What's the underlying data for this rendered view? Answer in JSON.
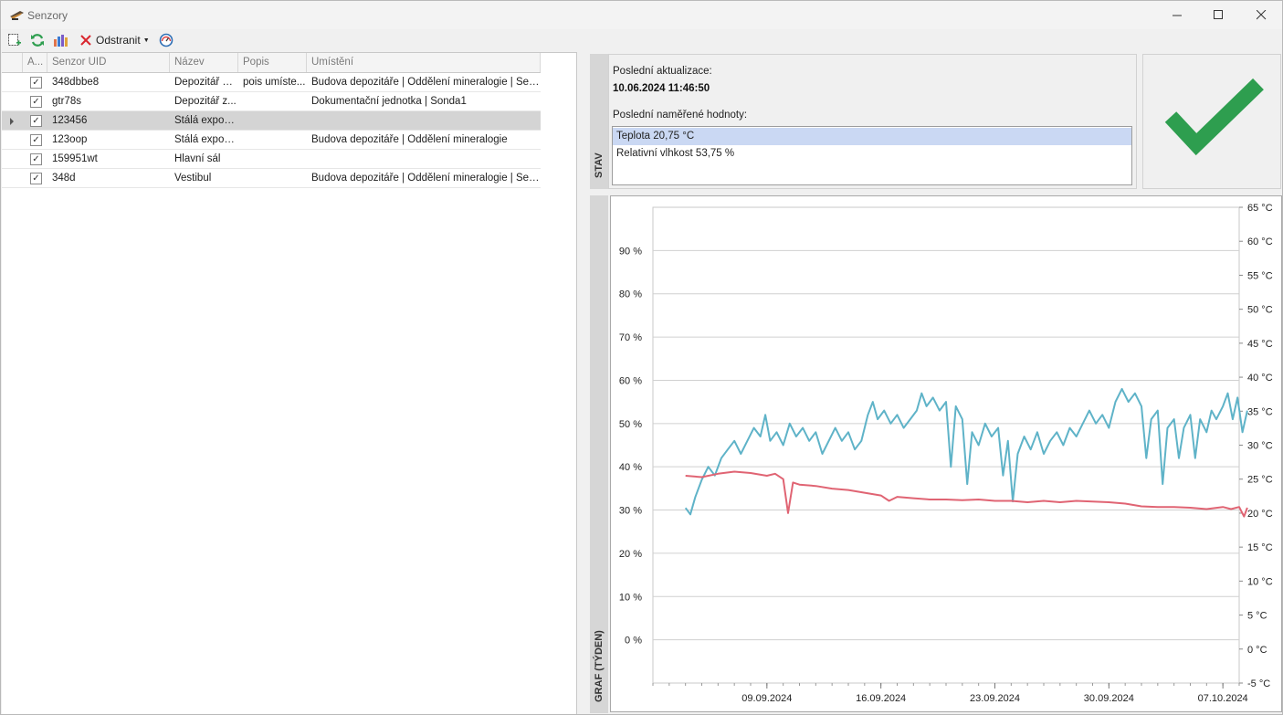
{
  "window": {
    "title": "Senzory"
  },
  "toolbar": {
    "delete_label": "Odstranit"
  },
  "grid": {
    "columns": [
      "A...",
      "Senzor UID",
      "Název",
      "Popis",
      "Umístění"
    ],
    "rows": [
      {
        "active": true,
        "uid": "348dbbe8",
        "name": "Depozitář 2 ...",
        "desc": "pois umíste...",
        "location": "Budova depozitáře | Oddělení mineralogie | Sekce 1"
      },
      {
        "active": true,
        "uid": "gtr78s",
        "name": "Depozitář z...",
        "desc": "",
        "location": "Dokumentační jednotka | Sonda1"
      },
      {
        "active": true,
        "uid": "123456",
        "name": "Stálá expozi...",
        "desc": "",
        "location": ""
      },
      {
        "active": true,
        "uid": "123oop",
        "name": "Stálá expozi...",
        "desc": "",
        "location": "Budova depozitáře | Oddělení mineralogie"
      },
      {
        "active": true,
        "uid": "159951wt",
        "name": "Hlavní sál",
        "desc": "",
        "location": ""
      },
      {
        "active": true,
        "uid": "348d",
        "name": "Vestibul",
        "desc": "",
        "location": "Budova depozitáře | Oddělení mineralogie | Sekce 1"
      }
    ],
    "selected_row": 2
  },
  "status": {
    "panel_label": "STAV",
    "last_update_label": "Poslední aktualizace:",
    "last_update_value": "10.06.2024 11:46:50",
    "last_values_label": "Poslední naměřené hodnoty:",
    "values": [
      "Teplota 20,75 °C",
      "Relativní vlhkost 53,75 %"
    ],
    "state": "ok",
    "state_color": "#2e9e4f"
  },
  "chart_panel_label": "GRAF (TÝDEN)",
  "chart_data": {
    "type": "line",
    "x_ticks": [
      "09.09.2024",
      "16.09.2024",
      "23.09.2024",
      "30.09.2024",
      "07.10.2024"
    ],
    "x_range": [
      "2024-09-02",
      "2024-10-08"
    ],
    "y_left": {
      "ticks": [
        "0 %",
        "10 %",
        "20 %",
        "30 %",
        "40 %",
        "50 %",
        "60 %",
        "70 %",
        "80 %",
        "90 %"
      ],
      "range": [
        -10,
        100
      ]
    },
    "y_right": {
      "ticks": [
        "-5 °C",
        "0 °C",
        "5 °C",
        "10 °C",
        "15 °C",
        "20 °C",
        "25 °C",
        "30 °C",
        "35 °C",
        "40 °C",
        "45 °C",
        "50 °C",
        "55 °C",
        "60 °C",
        "65 °C"
      ],
      "range": [
        -5,
        65
      ]
    },
    "grid": true,
    "series": [
      {
        "axis": "left",
        "color": "#5fb3c8",
        "points": [
          [
            "2024-09-04",
            30.5
          ],
          [
            "2024-09-04.3",
            29
          ],
          [
            "2024-09-04.6",
            33
          ],
          [
            "2024-09-05",
            37
          ],
          [
            "2024-09-05.4",
            40
          ],
          [
            "2024-09-05.8",
            38
          ],
          [
            "2024-09-06.2",
            42
          ],
          [
            "2024-09-06.6",
            44
          ],
          [
            "2024-09-07",
            46
          ],
          [
            "2024-09-07.4",
            43
          ],
          [
            "2024-09-07.8",
            46
          ],
          [
            "2024-09-08.2",
            49
          ],
          [
            "2024-09-08.6",
            47
          ],
          [
            "2024-09-08.9",
            52
          ],
          [
            "2024-09-09.2",
            46
          ],
          [
            "2024-09-09.6",
            48
          ],
          [
            "2024-09-10",
            45
          ],
          [
            "2024-09-10.4",
            50
          ],
          [
            "2024-09-10.8",
            47
          ],
          [
            "2024-09-11.2",
            49
          ],
          [
            "2024-09-11.6",
            46
          ],
          [
            "2024-09-12",
            48
          ],
          [
            "2024-09-12.4",
            43
          ],
          [
            "2024-09-12.8",
            46
          ],
          [
            "2024-09-13.2",
            49
          ],
          [
            "2024-09-13.6",
            46
          ],
          [
            "2024-09-14",
            48
          ],
          [
            "2024-09-14.4",
            44
          ],
          [
            "2024-09-14.8",
            46
          ],
          [
            "2024-09-15.2",
            52
          ],
          [
            "2024-09-15.5",
            55
          ],
          [
            "2024-09-15.8",
            51
          ],
          [
            "2024-09-16.2",
            53
          ],
          [
            "2024-09-16.6",
            50
          ],
          [
            "2024-09-17",
            52
          ],
          [
            "2024-09-17.4",
            49
          ],
          [
            "2024-09-17.8",
            51
          ],
          [
            "2024-09-18.2",
            53
          ],
          [
            "2024-09-18.5",
            57
          ],
          [
            "2024-09-18.8",
            54
          ],
          [
            "2024-09-19.2",
            56
          ],
          [
            "2024-09-19.6",
            53
          ],
          [
            "2024-09-20",
            55
          ],
          [
            "2024-09-20.3",
            40
          ],
          [
            "2024-09-20.6",
            54
          ],
          [
            "2024-09-21",
            51
          ],
          [
            "2024-09-21.3",
            36
          ],
          [
            "2024-09-21.6",
            48
          ],
          [
            "2024-09-22",
            45
          ],
          [
            "2024-09-22.4",
            50
          ],
          [
            "2024-09-22.8",
            47
          ],
          [
            "2024-09-23.2",
            49
          ],
          [
            "2024-09-23.5",
            38
          ],
          [
            "2024-09-23.8",
            46
          ],
          [
            "2024-09-24.1",
            32
          ],
          [
            "2024-09-24.4",
            43
          ],
          [
            "2024-09-24.8",
            47
          ],
          [
            "2024-09-25.2",
            44
          ],
          [
            "2024-09-25.6",
            48
          ],
          [
            "2024-09-26",
            43
          ],
          [
            "2024-09-26.4",
            46
          ],
          [
            "2024-09-26.8",
            48
          ],
          [
            "2024-09-27.2",
            45
          ],
          [
            "2024-09-27.6",
            49
          ],
          [
            "2024-09-28",
            47
          ],
          [
            "2024-09-28.4",
            50
          ],
          [
            "2024-09-28.8",
            53
          ],
          [
            "2024-09-29.2",
            50
          ],
          [
            "2024-09-29.6",
            52
          ],
          [
            "2024-09-30",
            49
          ],
          [
            "2024-09-30.4",
            55
          ],
          [
            "2024-09-30.8",
            58
          ],
          [
            "2024-10-01.2",
            55
          ],
          [
            "2024-10-01.6",
            57
          ],
          [
            "2024-10-02",
            54
          ],
          [
            "2024-10-02.3",
            42
          ],
          [
            "2024-10-02.6",
            51
          ],
          [
            "2024-10-03",
            53
          ],
          [
            "2024-10-03.3",
            36
          ],
          [
            "2024-10-03.6",
            49
          ],
          [
            "2024-10-04",
            51
          ],
          [
            "2024-10-04.3",
            42
          ],
          [
            "2024-10-04.6",
            49
          ],
          [
            "2024-10-05",
            52
          ],
          [
            "2024-10-05.3",
            42
          ],
          [
            "2024-10-05.6",
            51
          ],
          [
            "2024-10-06",
            48
          ],
          [
            "2024-10-06.3",
            53
          ],
          [
            "2024-10-06.6",
            51
          ],
          [
            "2024-10-07",
            54
          ],
          [
            "2024-10-07.3",
            57
          ],
          [
            "2024-10-07.6",
            51
          ],
          [
            "2024-10-07.9",
            56
          ],
          [
            "2024-10-08.2",
            48
          ],
          [
            "2024-10-08.5",
            53
          ]
        ]
      },
      {
        "axis": "right",
        "color": "#e06473",
        "points": [
          [
            "2024-09-04",
            25.5
          ],
          [
            "2024-09-05",
            25.3
          ],
          [
            "2024-09-06",
            25.8
          ],
          [
            "2024-09-07",
            26.1
          ],
          [
            "2024-09-08",
            25.9
          ],
          [
            "2024-09-09",
            25.5
          ],
          [
            "2024-09-09.5",
            25.8
          ],
          [
            "2024-09-10",
            25.0
          ],
          [
            "2024-09-10.3",
            20.0
          ],
          [
            "2024-09-10.6",
            24.5
          ],
          [
            "2024-09-11",
            24.2
          ],
          [
            "2024-09-12",
            24.0
          ],
          [
            "2024-09-13",
            23.6
          ],
          [
            "2024-09-14",
            23.4
          ],
          [
            "2024-09-15",
            23.0
          ],
          [
            "2024-09-16",
            22.6
          ],
          [
            "2024-09-16.5",
            21.8
          ],
          [
            "2024-09-17",
            22.4
          ],
          [
            "2024-09-18",
            22.2
          ],
          [
            "2024-09-19",
            22.0
          ],
          [
            "2024-09-20",
            22.0
          ],
          [
            "2024-09-21",
            21.9
          ],
          [
            "2024-09-22",
            22.0
          ],
          [
            "2024-09-23",
            21.8
          ],
          [
            "2024-09-24",
            21.8
          ],
          [
            "2024-09-25",
            21.6
          ],
          [
            "2024-09-26",
            21.8
          ],
          [
            "2024-09-27",
            21.6
          ],
          [
            "2024-09-28",
            21.8
          ],
          [
            "2024-09-29",
            21.7
          ],
          [
            "2024-09-30",
            21.6
          ],
          [
            "2024-10-01",
            21.4
          ],
          [
            "2024-10-02",
            21.0
          ],
          [
            "2024-10-03",
            20.9
          ],
          [
            "2024-10-04",
            20.9
          ],
          [
            "2024-10-05",
            20.8
          ],
          [
            "2024-10-06",
            20.6
          ],
          [
            "2024-10-07",
            20.9
          ],
          [
            "2024-10-07.5",
            20.6
          ],
          [
            "2024-10-08",
            20.9
          ],
          [
            "2024-10-08.3",
            19.5
          ],
          [
            "2024-10-08.5",
            20.8
          ]
        ]
      }
    ]
  }
}
